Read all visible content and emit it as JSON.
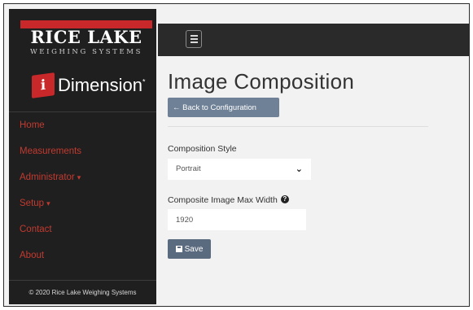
{
  "brand": {
    "logo_main": "RICE LAKE",
    "logo_sub": "WEIGHING SYSTEMS",
    "icon_letter": "i",
    "product_name": "Dimension",
    "trademark": "*"
  },
  "sidebar": {
    "items": [
      {
        "label": "Home",
        "caret": ""
      },
      {
        "label": "Measurements",
        "caret": ""
      },
      {
        "label": "Administrator",
        "caret": "▾"
      },
      {
        "label": "Setup",
        "caret": "▾"
      },
      {
        "label": "Contact",
        "caret": ""
      },
      {
        "label": "About",
        "caret": ""
      }
    ],
    "footer": "© 2020 Rice Lake Weighing Systems"
  },
  "header": {
    "menu_icon": "hamburger-icon"
  },
  "main": {
    "title": "Image Composition",
    "back_button": "← Back to Configuration",
    "composition_style": {
      "label": "Composition Style",
      "value": "Portrait"
    },
    "max_width": {
      "label": "Composite Image Max Width",
      "help": "?",
      "value": "1920"
    },
    "save_label": "Save"
  },
  "colors": {
    "accent_red": "#c8282a",
    "nav_text": "#c23a30",
    "sidebar_bg": "#1f1f1f",
    "topbar_bg": "#2a2a2a",
    "button_bg": "#6f8196"
  }
}
